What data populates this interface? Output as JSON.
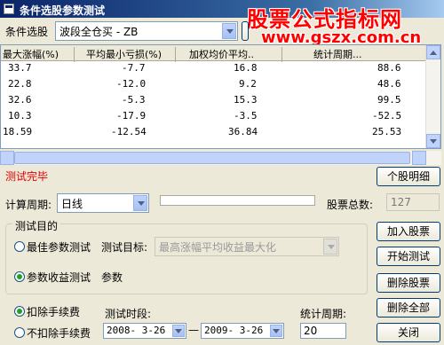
{
  "window": {
    "title": "条件选股参数测试"
  },
  "watermark": {
    "line1": "股票公式指标网",
    "line2": "www.gszx.com.cn"
  },
  "condition": {
    "label": "条件选股",
    "value": "波段全仓买  - ZB"
  },
  "table": {
    "headers": [
      "最大涨幅(%)",
      "平均最小亏损(%)",
      "加权均价平均..",
      "统计周期..."
    ],
    "rows": [
      [
        "33.7",
        "-7.7",
        "16.8",
        "88.6"
      ],
      [
        "22.8",
        "-12.0",
        "9.2",
        "48.6"
      ],
      [
        "32.6",
        "-5.3",
        "15.3",
        "99.5"
      ],
      [
        "10.3",
        "-17.9",
        "-3.5",
        "-52.5"
      ],
      [
        "18.59",
        "-12.54",
        "36.84",
        "25.53"
      ]
    ]
  },
  "status": {
    "text": "测试完毕",
    "color": "#e00000"
  },
  "buttons": {
    "detail": "个股明细",
    "add": "加入股票",
    "start": "开始测试",
    "delete": "删除股票",
    "delete_all": "删除全部",
    "close": "关闭"
  },
  "period": {
    "label": "计算周期:",
    "value": "日线"
  },
  "total": {
    "label": "股票总数:",
    "value": "127"
  },
  "purpose": {
    "group_label": "测试目的",
    "best_label": "最佳参数测试",
    "target_label": "测试目标:",
    "target_value": "最高涨幅平均收益最大化",
    "yield_label": "参数收益测试",
    "param_label": "参数"
  },
  "fees": {
    "deduct": "扣除手续费",
    "no_deduct": "不扣除手续费"
  },
  "test_period": {
    "label": "测试时段:",
    "start": "2008- 3-26",
    "dash": "—",
    "end": "2009- 3-26"
  },
  "stat_period": {
    "label": "统计周期:",
    "value": "20"
  }
}
